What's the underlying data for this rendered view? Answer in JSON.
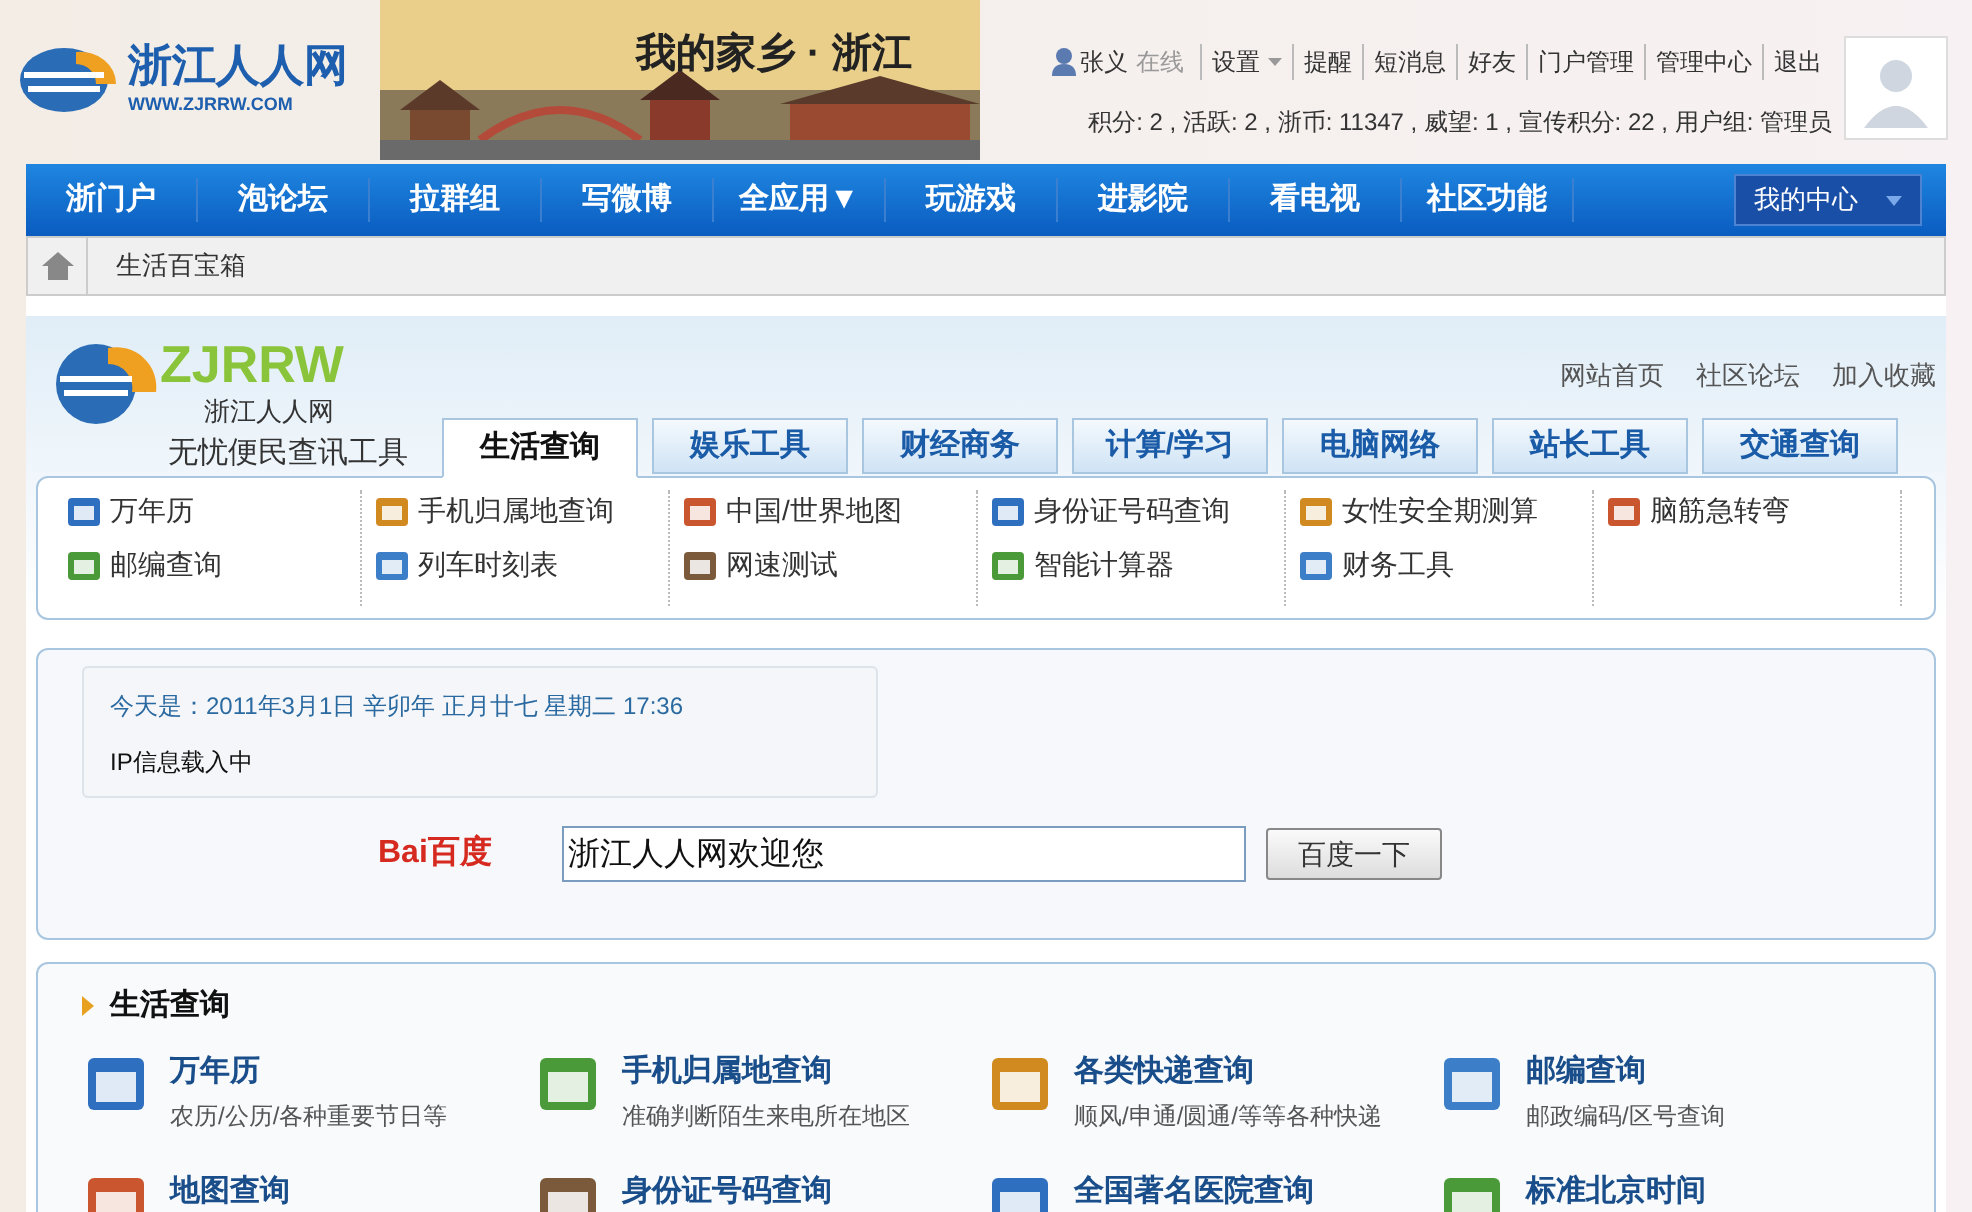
{
  "header": {
    "logo_text": "浙江人人网",
    "logo_url": "WWW.ZJRRW.COM",
    "banner_title": "我的家乡 · 浙江",
    "user": "张义",
    "status": "在线",
    "links": [
      {
        "label": "设置",
        "kind": "dropdown"
      },
      {
        "label": "提醒",
        "kind": "link"
      },
      {
        "label": "短消息",
        "kind": "link"
      },
      {
        "label": "好友",
        "kind": "link"
      },
      {
        "label": "门户管理",
        "kind": "link"
      },
      {
        "label": "管理中心",
        "kind": "link"
      },
      {
        "label": "退出",
        "kind": "link"
      }
    ],
    "stats": "积分: 2 , 活跃: 2 , 浙币: 11347 , 威望: 1 , 宣传积分: 22 , 用户组: 管理员"
  },
  "nav": {
    "items": [
      "浙门户",
      "泡论坛",
      "拉群组",
      "写微博",
      "全应用▼",
      "玩游戏",
      "进影院",
      "看电视",
      "社区功能"
    ],
    "my_center": "我的中心"
  },
  "breadcrumb": "生活百宝箱",
  "tools": {
    "logo": "ZJRRW",
    "logo_subtitle": "浙江人人网",
    "slogan": "无忧便民查讯工具",
    "top_links": [
      "网站首页",
      "社区论坛",
      "加入收藏"
    ],
    "tabs": [
      {
        "label": "生活查询",
        "selected": true
      },
      {
        "label": "娱乐工具",
        "selected": false
      },
      {
        "label": "财经商务",
        "selected": false
      },
      {
        "label": "计算/学习",
        "selected": false
      },
      {
        "label": "电脑网络",
        "selected": false
      },
      {
        "label": "站长工具",
        "selected": false
      },
      {
        "label": "交通查询",
        "selected": false
      }
    ],
    "links": [
      [
        "万年历",
        "邮编查询"
      ],
      [
        "手机归属地查询",
        "列车时刻表"
      ],
      [
        "中国/世界地图",
        "网速测试"
      ],
      [
        "身份证号码查询",
        "智能计算器"
      ],
      [
        "女性安全期测算",
        "财务工具"
      ],
      [
        "脑筋急转弯"
      ]
    ]
  },
  "info": {
    "date": "今天是：2011年3月1日 辛卯年 正月廿七 星期二 17:36",
    "ip": "IP信息载入中",
    "search_logo": "Bai百度",
    "search_value": "浙江人人网欢迎您",
    "search_button": "百度一下"
  },
  "section": {
    "title": "生活查询",
    "items": [
      {
        "title": "万年历",
        "desc": "农历/公历/各种重要节日等"
      },
      {
        "title": "手机归属地查询",
        "desc": "准确判断陌生来电所在地区"
      },
      {
        "title": "各类快递查询",
        "desc": "顺风/申通/圆通/等等各种快递"
      },
      {
        "title": "邮编查询",
        "desc": "邮政编码/区号查询"
      },
      {
        "title": "地图查询"
      },
      {
        "title": "身份证号码查询"
      },
      {
        "title": "全国著名医院查询"
      },
      {
        "title": "标准北京时间"
      }
    ]
  }
}
